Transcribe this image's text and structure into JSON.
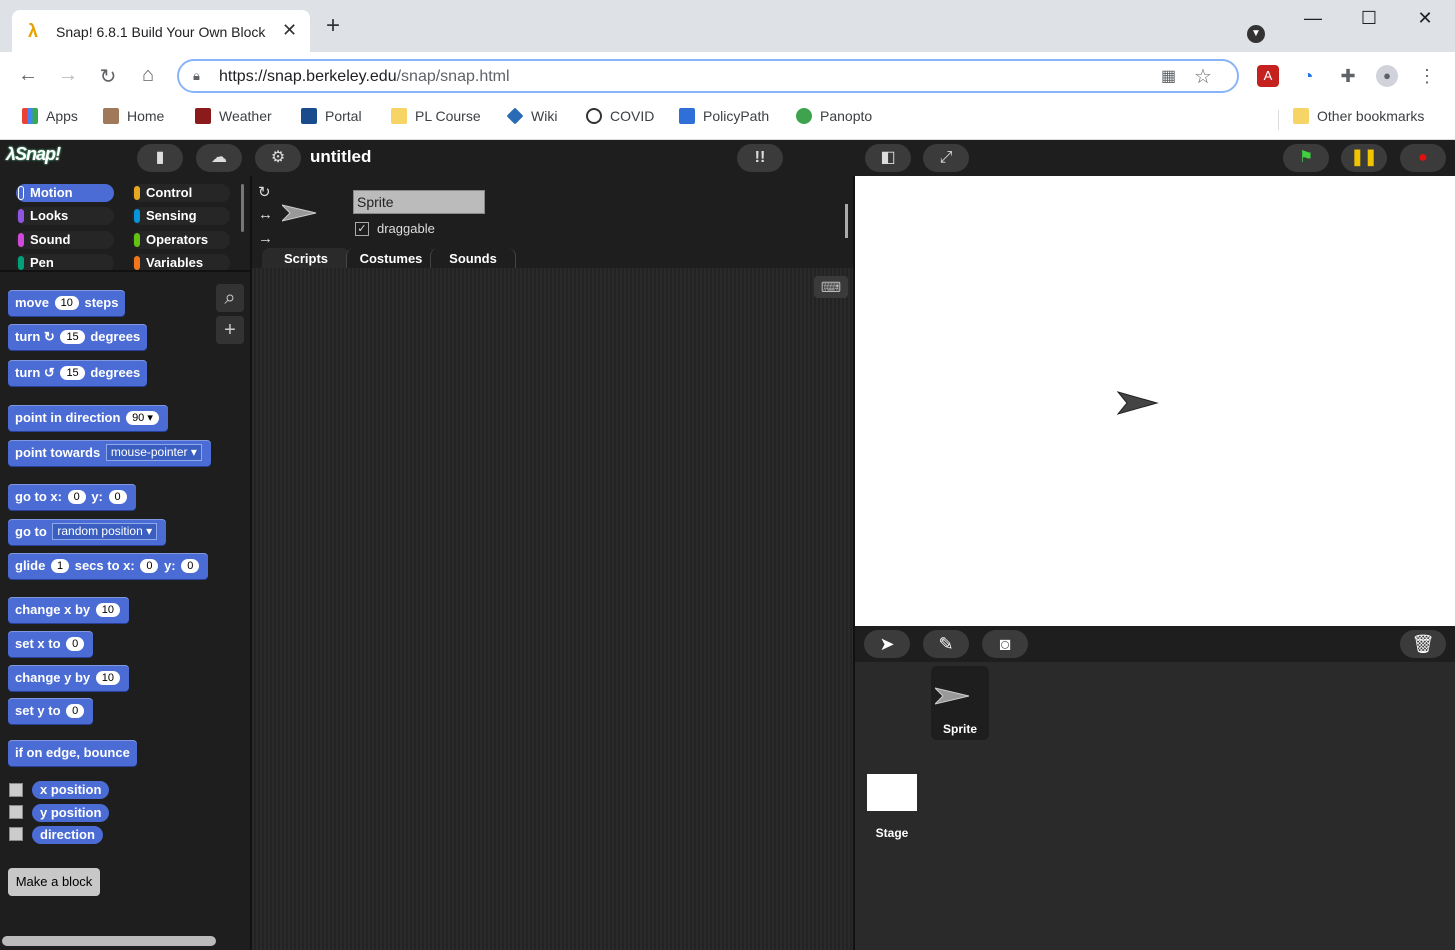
{
  "browser": {
    "tab_title": "Snap! 6.8.1 Build Your Own Block",
    "url_host": "https://snap.berkeley.edu",
    "url_path": "/snap/snap.html",
    "bookmarks": [
      {
        "label": "Apps",
        "icon": "apps-grid-icon",
        "color": "#4285f4"
      },
      {
        "label": "Home",
        "icon": "home-photo-icon",
        "color": "#a0785a"
      },
      {
        "label": "Weather",
        "icon": "weather-icon",
        "color": "#8b1a1a"
      },
      {
        "label": "Portal",
        "icon": "portal-icon",
        "color": "#1a4b8c"
      },
      {
        "label": "PL Course",
        "icon": "folder-icon",
        "color": "#f6d465"
      },
      {
        "label": "Wiki",
        "icon": "wiki-icon",
        "color": "#2a6bb5"
      },
      {
        "label": "COVID",
        "icon": "covid-icon",
        "color": "#333333"
      },
      {
        "label": "PolicyPath",
        "icon": "policypath-icon",
        "color": "#2e6fd8"
      },
      {
        "label": "Panopto",
        "icon": "panopto-icon",
        "color": "#3fa34d"
      }
    ],
    "other_bookmarks": "Other bookmarks"
  },
  "snap": {
    "project_title": "untitled",
    "categories": [
      {
        "label": "Motion",
        "color": "#4a6cd4",
        "selected": true
      },
      {
        "label": "Control",
        "color": "#e6a822"
      },
      {
        "label": "Looks",
        "color": "#8f56e3"
      },
      {
        "label": "Sensing",
        "color": "#0494dc"
      },
      {
        "label": "Sound",
        "color": "#cf4ad9"
      },
      {
        "label": "Operators",
        "color": "#62c213"
      },
      {
        "label": "Pen",
        "color": "#00a178"
      },
      {
        "label": "Variables",
        "color": "#f3761d"
      }
    ],
    "blocks": {
      "move": {
        "a": "move",
        "v": "10",
        "b": "steps"
      },
      "turn_cw": {
        "a": "turn",
        "icon": "↻",
        "v": "15",
        "b": "degrees"
      },
      "turn_ccw": {
        "a": "turn",
        "icon": "↺",
        "v": "15",
        "b": "degrees"
      },
      "point_dir": {
        "a": "point in direction",
        "v": "90"
      },
      "point_towards": {
        "a": "point towards",
        "v": "mouse-pointer"
      },
      "goto_xy": {
        "a": "go to x:",
        "x": "0",
        "b": "y:",
        "y": "0"
      },
      "goto": {
        "a": "go to",
        "v": "random position"
      },
      "glide": {
        "a": "glide",
        "v": "1",
        "b": "secs to x:",
        "x": "0",
        "c": "y:",
        "y": "0"
      },
      "change_x": {
        "a": "change x by",
        "v": "10"
      },
      "set_x": {
        "a": "set x to",
        "v": "0"
      },
      "change_y": {
        "a": "change y by",
        "v": "10"
      },
      "set_y": {
        "a": "set y to",
        "v": "0"
      },
      "bounce": {
        "a": "if on edge, bounce"
      },
      "x_pos": "x position",
      "y_pos": "y position",
      "direction": "direction"
    },
    "make_block": "Make a block",
    "sprite_name": "Sprite",
    "draggable_label": "draggable",
    "tabs": [
      "Scripts",
      "Costumes",
      "Sounds"
    ],
    "corral_sprite": "Sprite",
    "corral_stage": "Stage"
  }
}
